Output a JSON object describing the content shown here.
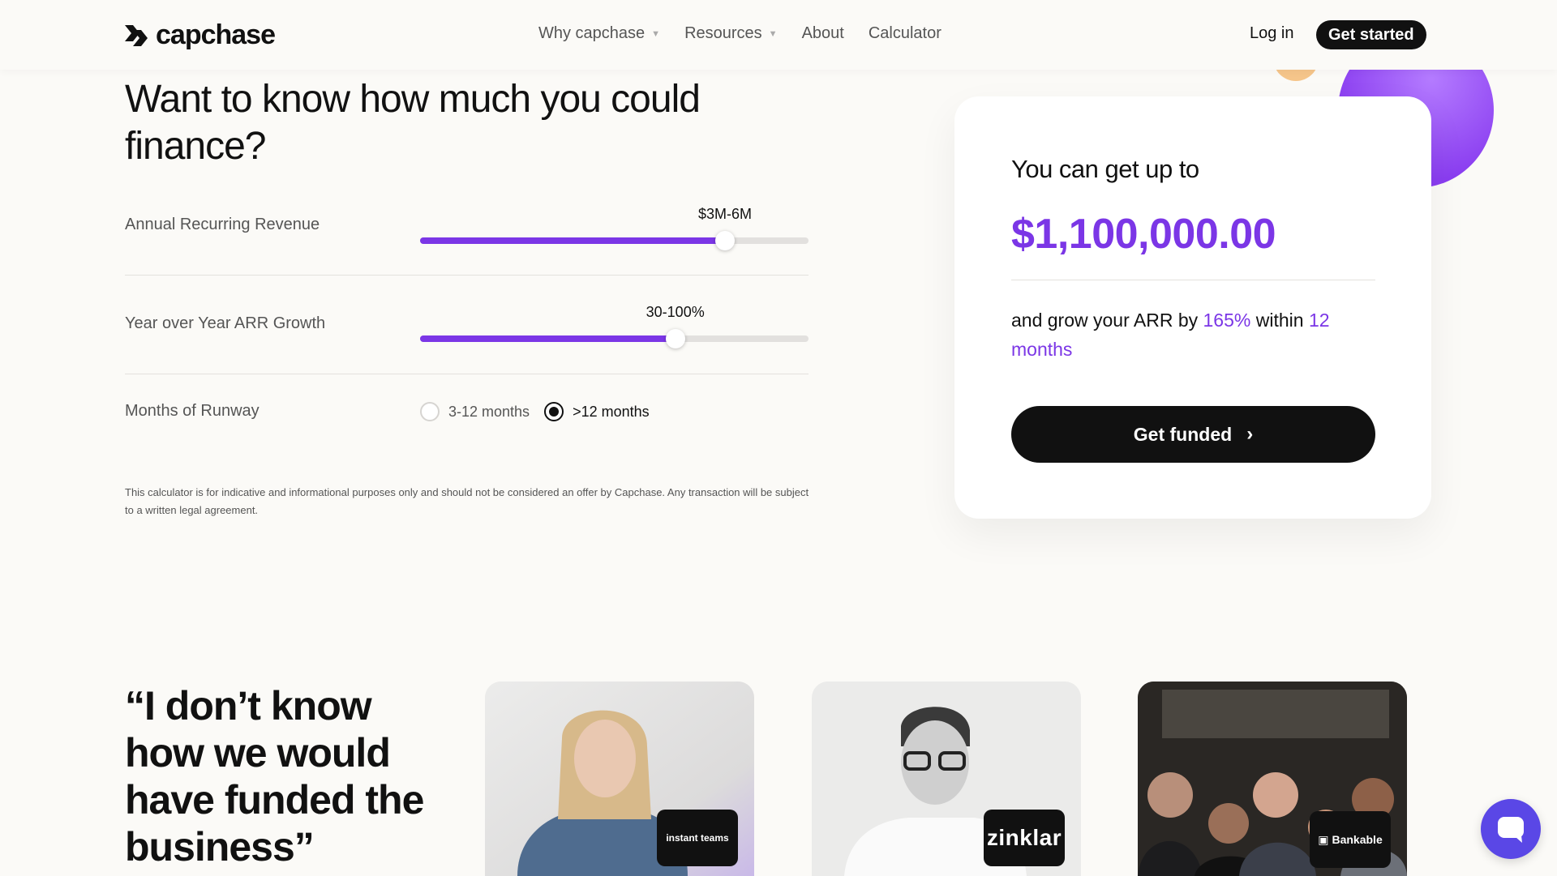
{
  "nav": {
    "brand": "capchase",
    "links": [
      {
        "label": "Why capchase",
        "has_dropdown": true
      },
      {
        "label": "Resources",
        "has_dropdown": true
      },
      {
        "label": "About",
        "has_dropdown": false
      },
      {
        "label": "Calculator",
        "has_dropdown": false
      }
    ],
    "login": "Log in",
    "cta": "Get started"
  },
  "calculator": {
    "headline": "Want to know how much you could finance?",
    "arr": {
      "label": "Annual Recurring Revenue",
      "value": "$3M-6M",
      "level": 0.785
    },
    "growth": {
      "label": "Year over Year ARR Growth",
      "value": "30-100%",
      "level": 0.657
    },
    "runway": {
      "label": "Months of Runway",
      "options": [
        {
          "label": "3-12 months",
          "selected": false
        },
        {
          "label": ">12 months",
          "selected": true
        }
      ]
    },
    "disclaimer": "This calculator is for indicative and informational purposes only and should not be considered an offer by Capchase.  Any transaction will be subject to a written legal agreement."
  },
  "result": {
    "intro": "You can get up to",
    "amount": "$1,100,000.00",
    "growth_prefix": "and grow your ARR by ",
    "growth_pct": "165%",
    "growth_mid": " within ",
    "growth_period": "12 months",
    "cta": "Get funded"
  },
  "testimonials": {
    "quote": "“I don’t know how we would have funded the business”",
    "cards": [
      {
        "company": "instant teams"
      },
      {
        "company": "zinklar"
      },
      {
        "company": "Bankable"
      }
    ]
  },
  "colors": {
    "accent": "#7b36e6",
    "dark": "#111111",
    "background": "#fbfaf7"
  }
}
